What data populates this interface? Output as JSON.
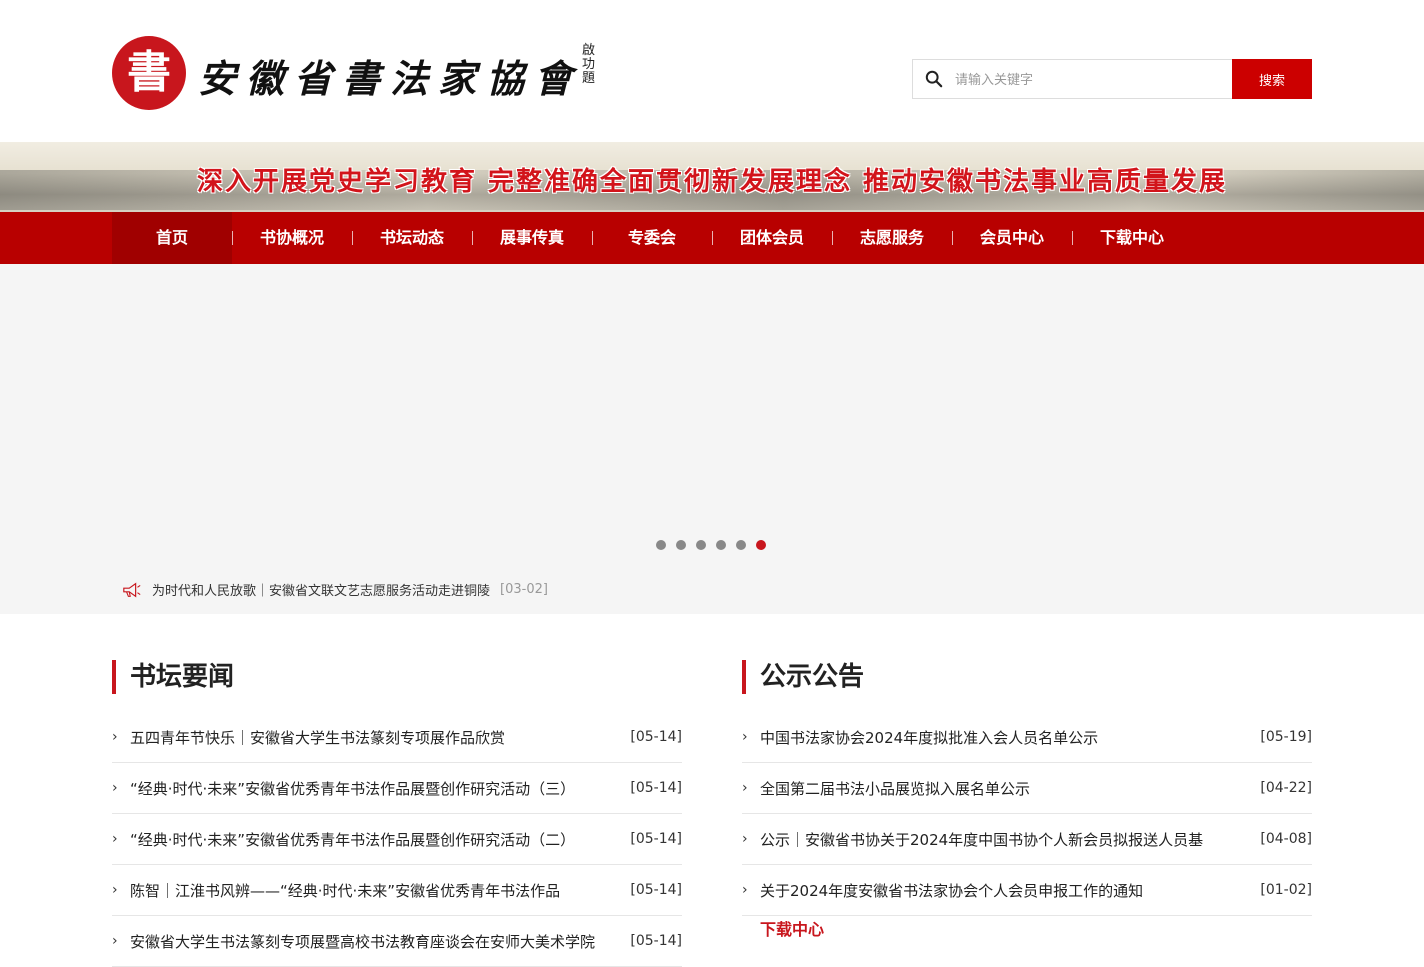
{
  "header": {
    "seal_char": "書",
    "logo_text": "安徽省書法家協會",
    "logo_signature": "啟功題",
    "search_placeholder": "请输入关键字",
    "search_button": "搜索"
  },
  "banner": {
    "slogan": "深入开展党史学习教育 完整准确全面贯彻新发展理念 推动安徽书法事业高质量发展"
  },
  "nav": {
    "items": [
      "首页",
      "书协概况",
      "书坛动态",
      "展事传真",
      "专委会",
      "团体会员",
      "志愿服务",
      "会员中心",
      "下载中心"
    ],
    "active_index": 0
  },
  "slider": {
    "dot_count": 6,
    "active_dot": 6,
    "ticker_text": "为时代和人民放歌｜安徽省文联文艺志愿服务活动走进铜陵",
    "ticker_date": "[03-02]"
  },
  "news": {
    "title": "书坛要闻",
    "items": [
      {
        "title": "五四青年节快乐｜安徽省大学生书法篆刻专项展作品欣赏",
        "date": "[05-14]"
      },
      {
        "title": "“经典·时代·未来”安徽省优秀青年书法作品展暨创作研究活动（三）",
        "date": "[05-14]"
      },
      {
        "title": "“经典·时代·未来”安徽省优秀青年书法作品展暨创作研究活动（二）",
        "date": "[05-14]"
      },
      {
        "title": "陈智｜江淮书风辨——“经典·时代·未来”安徽省优秀青年书法作品",
        "date": "[05-14]"
      },
      {
        "title": "安徽省大学生书法篆刻专项展暨高校书法教育座谈会在安师大美术学院",
        "date": "[05-14]"
      }
    ]
  },
  "notices": {
    "title": "公示公告",
    "items": [
      {
        "title": "中国书法家协会2024年度拟批准入会人员名单公示",
        "date": "[05-19]"
      },
      {
        "title": "全国第二届书法小品展览拟入展名单公示",
        "date": "[04-22]"
      },
      {
        "title": "公示｜安徽省书协关于2024年度中国书协个人新会员拟报送人员基",
        "date": "[04-08]"
      },
      {
        "title": "关于2024年度安徽省书法家协会个人会员申报工作的通知",
        "date": "[01-02]"
      }
    ],
    "more_link": "下载中心"
  },
  "colors": {
    "brand_red": "#c8161d",
    "nav_red": "#b80000"
  }
}
